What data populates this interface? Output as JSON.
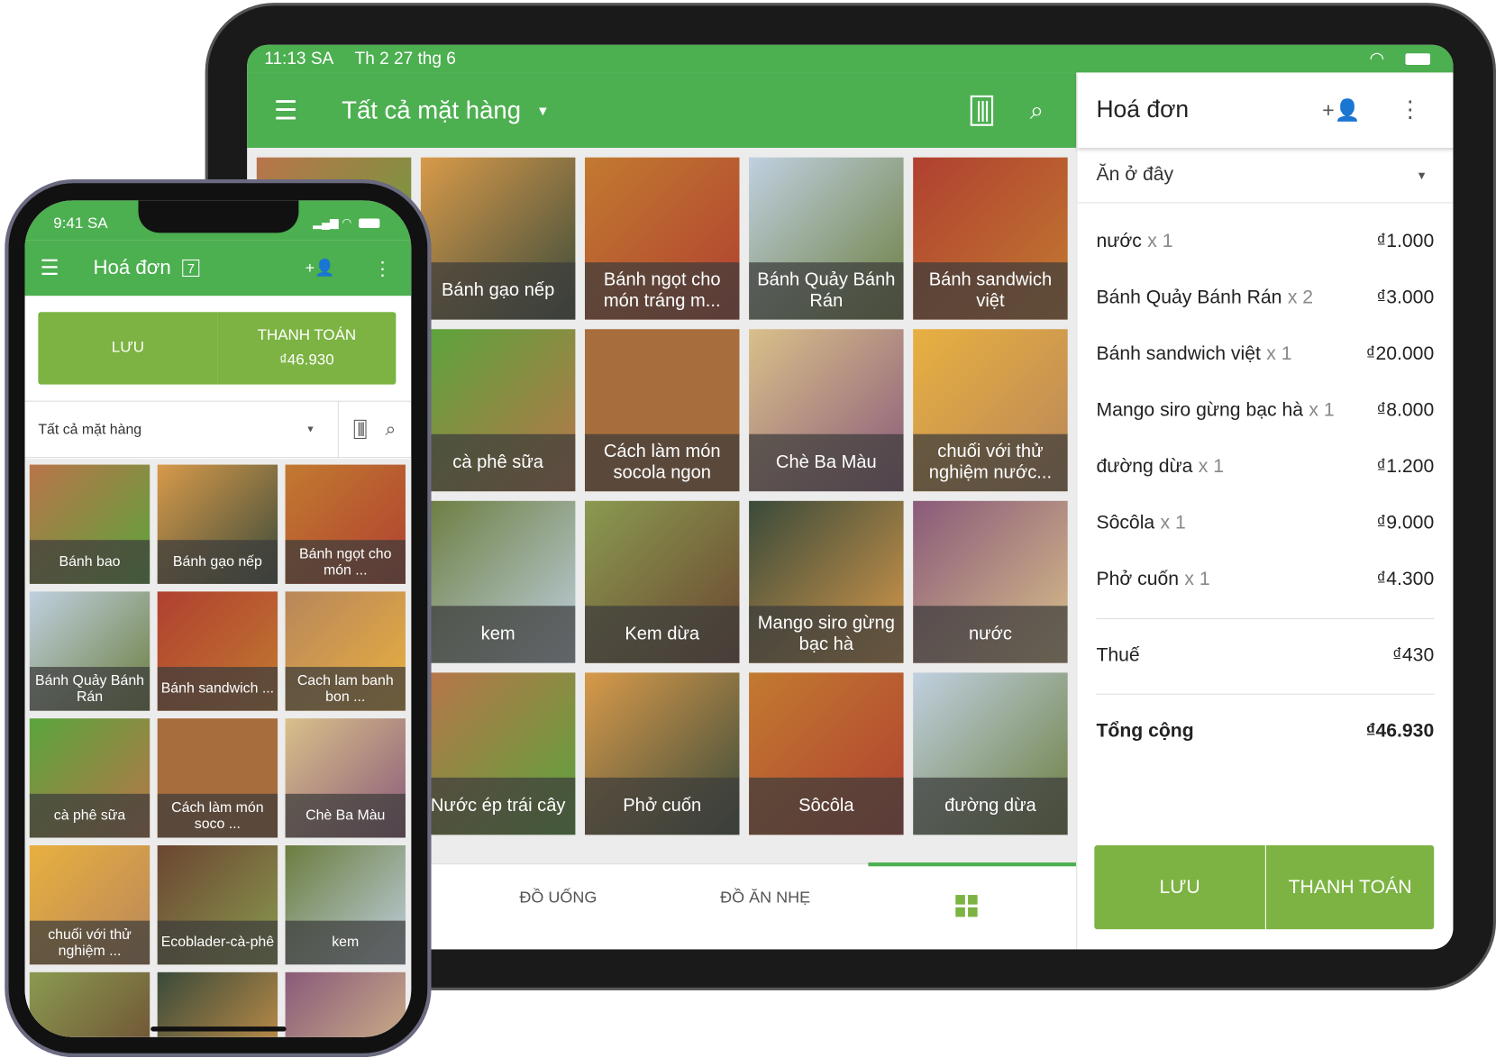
{
  "colors": {
    "primary": "#4caf50",
    "button": "#7cb342"
  },
  "tablet": {
    "status": {
      "time": "11:13 SA",
      "date": "Th 2 27 thg 6"
    },
    "appbar": {
      "title": "Tất cả mặt hàng",
      "icons": [
        "menu-icon",
        "chevron-down-icon",
        "barcode-icon",
        "search-icon"
      ]
    },
    "tiles": [
      {
        "label": ""
      },
      {
        "label": "Bánh gạo nếp"
      },
      {
        "label": "Bánh ngọt cho món tráng m..."
      },
      {
        "label": "Bánh Quảy Bánh Rán"
      },
      {
        "label": "Bánh sandwich việt"
      },
      {
        "label": ""
      },
      {
        "label": "cà phê sữa"
      },
      {
        "label": "Cách làm món socola ngon"
      },
      {
        "label": "Chè Ba Màu"
      },
      {
        "label": "chuối với thử nghiệm nước..."
      },
      {
        "label": ""
      },
      {
        "label": "kem"
      },
      {
        "label": "Kem dừa"
      },
      {
        "label": "Mango siro gừng bạc hà"
      },
      {
        "label": "nước"
      },
      {
        "label": ""
      },
      {
        "label": "Nước ép trái cây"
      },
      {
        "label": "Phở cuốn"
      },
      {
        "label": "Sôcôla"
      },
      {
        "label": "đường dừa"
      }
    ],
    "tabs": [
      {
        "label": "ĐỒ UỐNG"
      },
      {
        "label": "ĐỒ ĂN NHẸ"
      },
      {
        "label": "",
        "icon": "grid-icon",
        "active": true
      }
    ],
    "invoice": {
      "title": "Hoá đơn",
      "order_type": "Ăn ở đây",
      "items": [
        {
          "name": "nước",
          "qty": "x 1",
          "price": "₫1.000"
        },
        {
          "name": "Bánh Quảy Bánh Rán",
          "qty": "x 2",
          "price": "₫3.000"
        },
        {
          "name": "Bánh sandwich việt",
          "qty": "x 1",
          "price": "₫20.000"
        },
        {
          "name": "Mango siro gừng bạc hà",
          "qty": "x 1",
          "price": "₫8.000"
        },
        {
          "name": "đường dừa",
          "qty": "x 1",
          "price": "₫1.200"
        },
        {
          "name": "Sôcôla",
          "qty": "x 1",
          "price": "₫9.000"
        },
        {
          "name": "Phở cuốn",
          "qty": "x 1",
          "price": "₫4.300"
        }
      ],
      "tax_label": "Thuế",
      "tax": "₫430",
      "total_label": "Tổng cộng",
      "total": "₫46.930",
      "save": "LƯU",
      "pay": "THANH TOÁN"
    }
  },
  "phone": {
    "status": {
      "time": "9:41 SA"
    },
    "appbar": {
      "title": "Hoá đơn",
      "badge": "7"
    },
    "save": "LƯU",
    "pay": "THANH TOÁN",
    "pay_amount": "₫46.930",
    "filter": "Tất cả mặt hàng",
    "tiles": [
      {
        "label": "Bánh bao"
      },
      {
        "label": "Bánh gạo nếp"
      },
      {
        "label": "Bánh ngọt cho món ..."
      },
      {
        "label": "Bánh Quảy Bánh Rán"
      },
      {
        "label": "Bánh sandwich ..."
      },
      {
        "label": "Cach lam banh bon ..."
      },
      {
        "label": "cà phê sữa"
      },
      {
        "label": "Cách làm món soco ..."
      },
      {
        "label": "Chè Ba Màu"
      },
      {
        "label": "chuối với thử nghiệm ..."
      },
      {
        "label": "Ecoblader-cà-phê"
      },
      {
        "label": "kem"
      },
      {
        "label": ""
      },
      {
        "label": ""
      },
      {
        "label": ""
      }
    ]
  }
}
